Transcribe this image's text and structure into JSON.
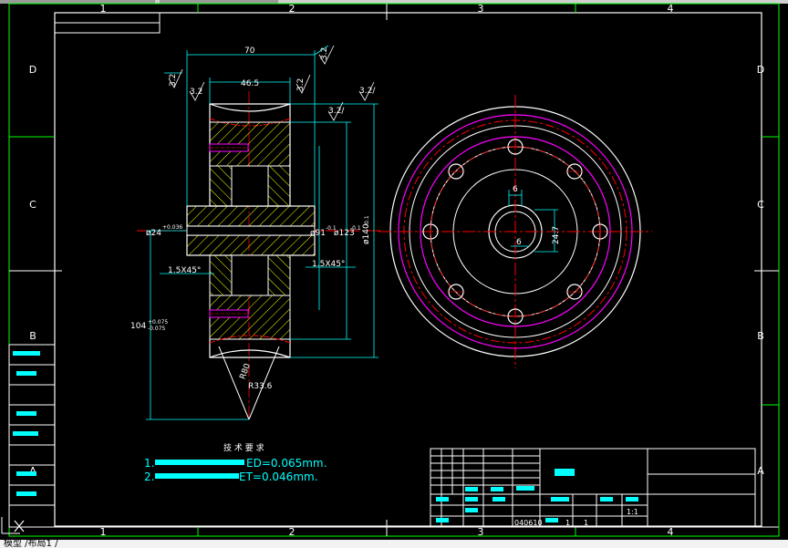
{
  "zone_labels": {
    "columns": [
      "1",
      "2",
      "3",
      "4"
    ],
    "rows": [
      "D",
      "C",
      "B",
      "A"
    ]
  },
  "dimensions": {
    "width_70": "70",
    "width_46_5": "46.5",
    "rough_3_2": "3.2",
    "rough_3_2_alt": "3.2/",
    "rough_3_2_top": "3.2",
    "dia_24": "ø24",
    "dia_24_tol": "+0.036",
    "dia_91": "ø91",
    "dia_91_tol": "-0.1",
    "dia_123": "ø123",
    "dia_123_tol": "-0.1",
    "dia_140": "ø140",
    "dia_140_tol": "-0.1",
    "chamfer_1": "1.5X45°",
    "chamfer_2": "1.5X45°",
    "dim_104": "104",
    "dim_104_tol_up": "+0.075",
    "dim_104_tol_dn": "-0.075",
    "r80": "R80",
    "r33": "R33.6",
    "keyway_6": "6",
    "keyway_24": "24.7",
    "keyway_6b": "6"
  },
  "notes": {
    "heading": "技 术 要 求",
    "line1_prefix": "1.",
    "line1_value": "ED=0.065mm.",
    "line2_prefix": "2.",
    "line2_value": "ET=0.046mm."
  },
  "title_block": {
    "ratio": "1:1",
    "code": "040610",
    "count_1": "1",
    "count_2": "1"
  },
  "colors": {
    "frame": "#ffffff",
    "grid": "#00ff00",
    "dims": "#00ffff",
    "center": "#ff0000",
    "pitch": "#ff00ff",
    "hatch": "#ffff00"
  },
  "status": {
    "prompt": "模型 /布局1 /"
  }
}
